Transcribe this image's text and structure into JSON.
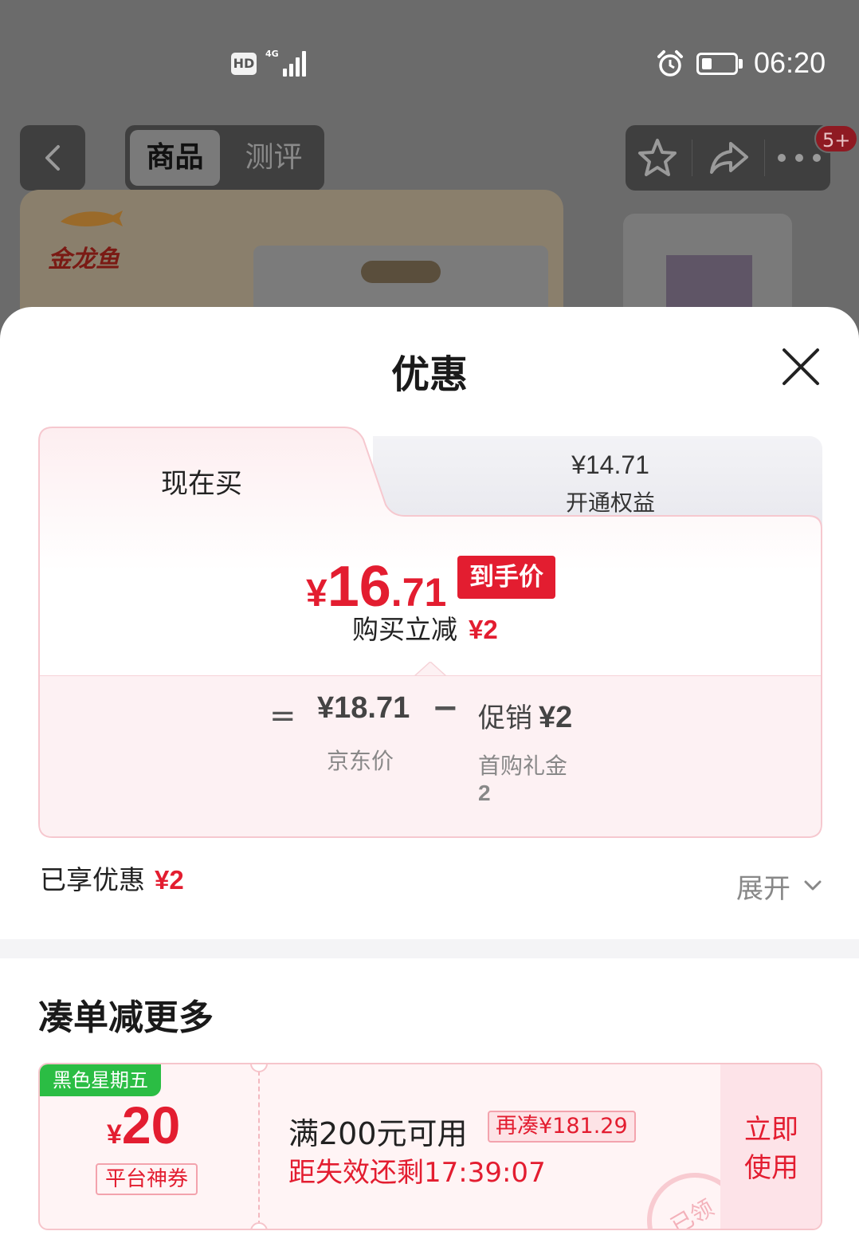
{
  "status_bar": {
    "hd": "HD",
    "network": "4G",
    "time": "06:20"
  },
  "nav": {
    "tabs": [
      {
        "label": "商品",
        "active": true
      },
      {
        "label": "测评",
        "active": false
      }
    ],
    "badge": "5+",
    "icons": [
      "chevron-left-icon",
      "star-icon",
      "share-icon",
      "more-icon"
    ]
  },
  "product_image": {
    "brand": "金龙鱼"
  },
  "sheet": {
    "title": "优惠"
  },
  "price_tabs": {
    "now": "现在买",
    "member_price": "¥14.71",
    "member_label": "开通权益"
  },
  "final_price": {
    "currency": "¥",
    "integer": "16",
    "decimal": ".71",
    "tag": "到手价",
    "instant_label": "购买立减",
    "instant_amount": "¥2"
  },
  "formula": {
    "equals": "=",
    "base_price": "¥18.71",
    "base_label": "京东价",
    "minus": "−",
    "promo_label": "促销",
    "promo_value": "¥2",
    "gift_label": "首购礼金",
    "gift_value": "2"
  },
  "enjoyed": {
    "label": "已享优惠",
    "amount": "¥2",
    "expand": "展开"
  },
  "more_section": {
    "title": "凑单减更多"
  },
  "coupon": {
    "badge": "黑色星期五",
    "currency": "¥",
    "amount": "20",
    "type": "平台神券",
    "condition": "满200元可用",
    "more_needed": "再凑¥181.29",
    "expire": "距失效还剩17:39:07",
    "use": "立即使用",
    "stamp": "已领"
  },
  "colors": {
    "accent_red": "#e31d30",
    "badge_green": "#2bbd44"
  }
}
